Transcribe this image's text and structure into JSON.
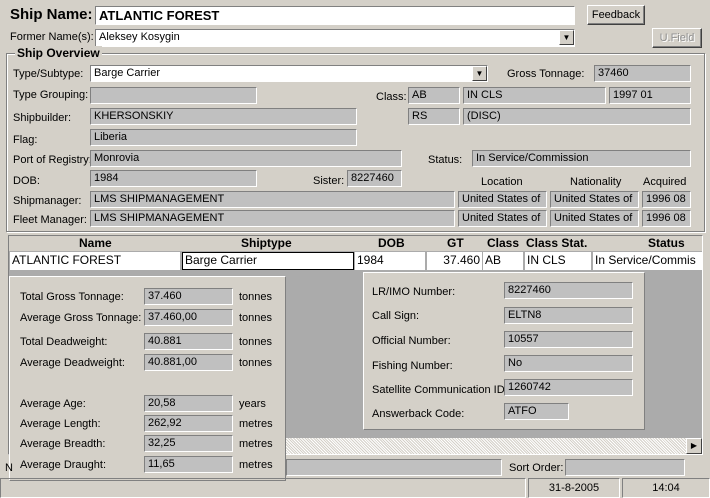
{
  "header": {
    "ship_name_label": "Ship Name:",
    "ship_name_value": "ATLANTIC FOREST",
    "feedback_label": "Feedback",
    "former_names_label": "Former Name(s):",
    "former_names_value": "Aleksey Kosygin",
    "ufield_label": "U.Field"
  },
  "overview": {
    "title": "Ship Overview",
    "type_subtype_label": "Type/Subtype:",
    "type_subtype_value": "Barge Carrier",
    "gross_tonnage_label": "Gross Tonnage:",
    "gross_tonnage_value": "37460",
    "type_grouping_label": "Type Grouping:",
    "type_grouping_value": "",
    "class_label": "Class:",
    "class_value": "AB",
    "class_status": "IN CLS",
    "class_date": "1997 01",
    "shipbuilder_label": "Shipbuilder:",
    "shipbuilder_value": "KHERSONSKIY",
    "class2_value": "RS",
    "class2_status": "(DISC)",
    "flag_label": "Flag:",
    "flag_value": "Liberia",
    "port_label": "Port of Registry:",
    "port_value": "Monrovia",
    "status_label": "Status:",
    "status_value": "In Service/Commission",
    "dob_label": "DOB:",
    "dob_value": "1984",
    "sister_label": "Sister:",
    "sister_value": "8227460",
    "location_header": "Location",
    "nationality_header": "Nationality",
    "acquired_header": "Acquired",
    "shipmanager_label": "Shipmanager:",
    "shipmanager_value": "LMS SHIPMANAGEMENT",
    "shipmanager_location": "United States of",
    "shipmanager_nationality": "United States of",
    "shipmanager_acquired": "1996 08",
    "fleet_manager_label": "Fleet Manager:",
    "fleet_manager_value": "LMS SHIPMANAGEMENT",
    "fleet_manager_location": "United States of",
    "fleet_manager_nationality": "United States of",
    "fleet_manager_acquired": "1996 08"
  },
  "grid": {
    "columns": [
      "Name",
      "Shiptype",
      "DOB",
      "GT",
      "Class",
      "Class Stat.",
      "Status"
    ],
    "rows": [
      [
        "ATLANTIC FOREST",
        "Barge Carrier",
        "1984",
        "37.460",
        "AB",
        "IN CLS",
        "In Service/Commis"
      ]
    ]
  },
  "stats": {
    "total_gt_label": "Total Gross Tonnage:",
    "total_gt_value": "37.460",
    "total_gt_unit": "tonnes",
    "avg_gt_label": "Average Gross Tonnage:",
    "avg_gt_value": "37.460,00",
    "avg_gt_unit": "tonnes",
    "total_dwt_label": "Total Deadweight:",
    "total_dwt_value": "40.881",
    "total_dwt_unit": "tonnes",
    "avg_dwt_label": "Average Deadweight:",
    "avg_dwt_value": "40.881,00",
    "avg_dwt_unit": "tonnes",
    "avg_age_label": "Average Age:",
    "avg_age_value": "20,58",
    "avg_age_unit": "years",
    "avg_length_label": "Average Length:",
    "avg_length_value": "262,92",
    "avg_length_unit": "metres",
    "avg_breadth_label": "Average Breadth:",
    "avg_breadth_value": "32,25",
    "avg_breadth_unit": "metres",
    "avg_draught_label": "Average Draught:",
    "avg_draught_value": "11,65",
    "avg_draught_unit": "metres"
  },
  "ids": {
    "imo_label": "LR/IMO Number:",
    "imo_value": "8227460",
    "callsign_label": "Call Sign:",
    "callsign_value": "ELTN8",
    "official_label": "Official Number:",
    "official_value": "10557",
    "fishing_label": "Fishing Number:",
    "fishing_value": "No",
    "satcom_label": "Satellite Communication ID:",
    "satcom_value": "1260742",
    "answerback_label": "Answerback Code:",
    "answerback_value": "ATFO"
  },
  "bottom": {
    "left_label_fragment": "N",
    "sort_order_label": "Sort Order:",
    "sort_order_value": ""
  },
  "statusbar": {
    "date": "31-8-2005",
    "time": "14:04"
  }
}
